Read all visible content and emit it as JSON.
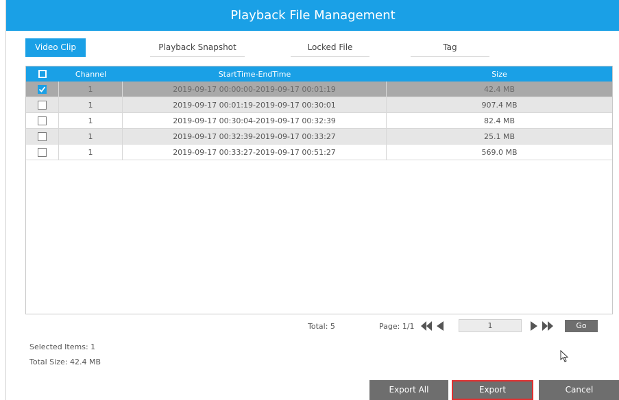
{
  "title": "Playback File Management",
  "tabs": [
    {
      "label": "Video Clip",
      "active": true
    },
    {
      "label": "Playback Snapshot",
      "active": false
    },
    {
      "label": "Locked File",
      "active": false
    },
    {
      "label": "Tag",
      "active": false
    }
  ],
  "table": {
    "headers": [
      "Channel",
      "StartTime-EndTime",
      "Size"
    ],
    "rows": [
      {
        "checked": true,
        "channel": "1",
        "time": "2019-09-17 00:00:00-2019-09-17 00:01:19",
        "size": "42.4 MB"
      },
      {
        "checked": false,
        "channel": "1",
        "time": "2019-09-17 00:01:19-2019-09-17 00:30:01",
        "size": "907.4 MB"
      },
      {
        "checked": false,
        "channel": "1",
        "time": "2019-09-17 00:30:04-2019-09-17 00:32:39",
        "size": "82.4 MB"
      },
      {
        "checked": false,
        "channel": "1",
        "time": "2019-09-17 00:32:39-2019-09-17 00:33:27",
        "size": "25.1 MB"
      },
      {
        "checked": false,
        "channel": "1",
        "time": "2019-09-17 00:33:27-2019-09-17 00:51:27",
        "size": "569.0 MB"
      }
    ]
  },
  "pagination": {
    "total": "Total: 5",
    "page": "Page: 1/1",
    "page_input": "1",
    "go": "Go"
  },
  "summary": {
    "selected": "Selected Items: 1",
    "total_size": "Total Size: 42.4 MB"
  },
  "buttons": {
    "export_all": "Export All",
    "export": "Export",
    "cancel": "Cancel"
  },
  "colors": {
    "accent": "#1aa0e6",
    "button": "#6e6e6e",
    "highlight": "#e03030"
  }
}
